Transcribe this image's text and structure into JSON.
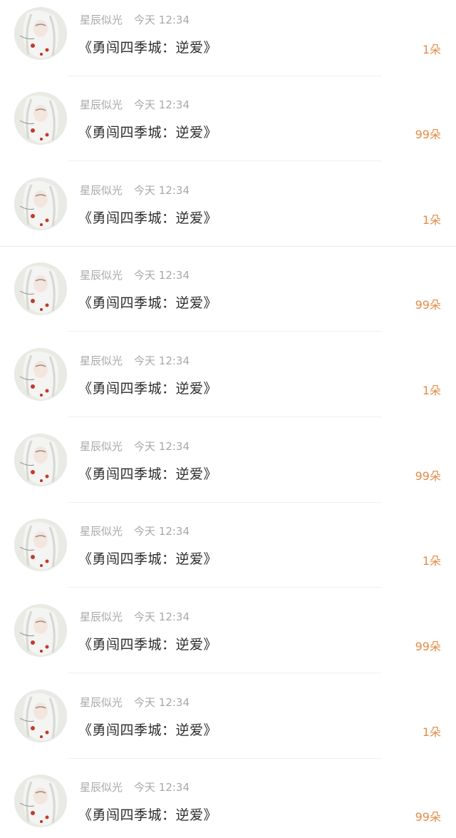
{
  "gifts": [
    {
      "user": "星辰似光",
      "time": "今天  12:34",
      "title": "《勇闯四季城：逆爱》",
      "count": "1朵"
    },
    {
      "user": "星辰似光",
      "time": "今天  12:34",
      "title": "《勇闯四季城：逆爱》",
      "count": "99朵"
    },
    {
      "user": "星辰似光",
      "time": "今天  12:34",
      "title": "《勇闯四季城：逆爱》",
      "count": "1朵"
    },
    {
      "user": "星辰似光",
      "time": "今天  12:34",
      "title": "《勇闯四季城：逆爱》",
      "count": "99朵"
    },
    {
      "user": "星辰似光",
      "time": "今天  12:34",
      "title": "《勇闯四季城：逆爱》",
      "count": "1朵"
    },
    {
      "user": "星辰似光",
      "time": "今天  12:34",
      "title": "《勇闯四季城：逆爱》",
      "count": "99朵"
    },
    {
      "user": "星辰似光",
      "time": "今天  12:34",
      "title": "《勇闯四季城：逆爱》",
      "count": "1朵"
    },
    {
      "user": "星辰似光",
      "time": "今天  12:34",
      "title": "《勇闯四季城：逆爱》",
      "count": "99朵"
    },
    {
      "user": "星辰似光",
      "time": "今天  12:34",
      "title": "《勇闯四季城：逆爱》",
      "count": "1朵"
    },
    {
      "user": "星辰似光",
      "time": "今天  12:34",
      "title": "《勇闯四季城：逆爱》",
      "count": "99朵"
    }
  ],
  "colors": {
    "accent": "#e58b47",
    "meta": "#a8a8a8",
    "title": "#2b2b2b",
    "divider": "#efefef"
  },
  "icons": {
    "avatar": "avatar-image"
  }
}
